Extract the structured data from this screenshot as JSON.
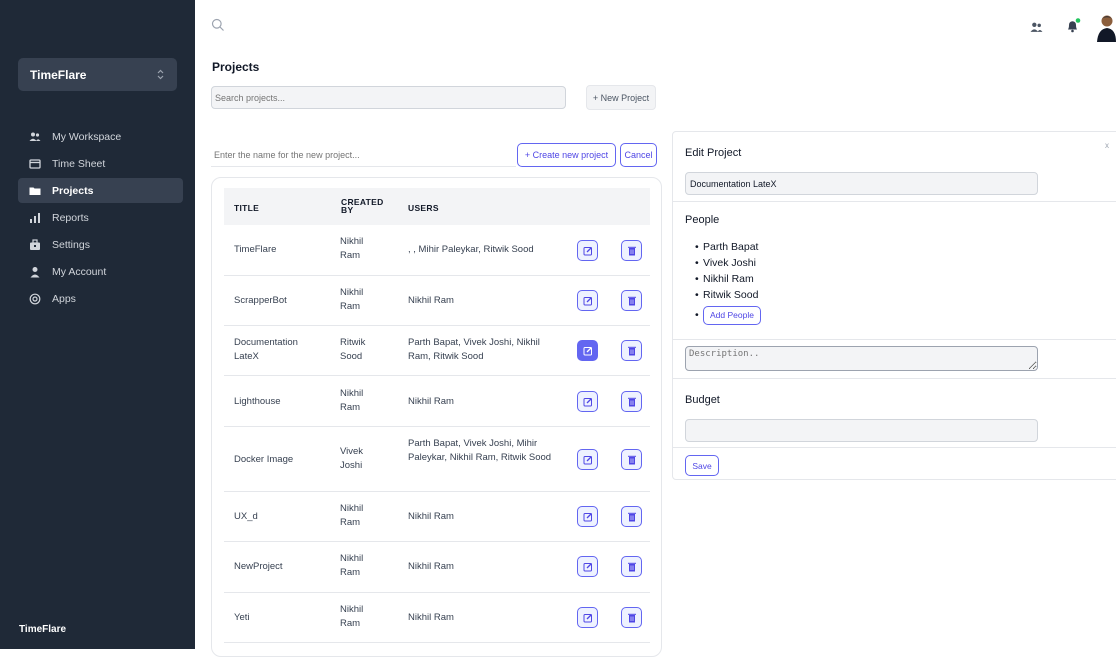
{
  "sidebar": {
    "workspace": "TimeFlare",
    "items": [
      {
        "label": "My Workspace",
        "icon": "users-icon"
      },
      {
        "label": "Time Sheet",
        "icon": "monitor-icon"
      },
      {
        "label": "Projects",
        "icon": "folder-icon",
        "active": true
      },
      {
        "label": "Reports",
        "icon": "bar-chart-icon"
      },
      {
        "label": "Settings",
        "icon": "briefcase-icon"
      },
      {
        "label": "My Account",
        "icon": "user-icon"
      },
      {
        "label": "Apps",
        "icon": "apps-icon"
      }
    ],
    "footer": "TimeFlare"
  },
  "header": {
    "page_title": "Projects",
    "search_placeholder": "Search projects...",
    "new_project_label": "+ New Project"
  },
  "new_project_form": {
    "placeholder": "Enter the name for the new project...",
    "create_label": "+ Create new project",
    "cancel_label": "Cancel"
  },
  "table": {
    "headers": {
      "title": "TITLE",
      "created_by": "CREATED BY",
      "users": "USERS"
    },
    "rows": [
      {
        "title": "TimeFlare",
        "created_by": "Nikhil Ram",
        "users": ", , Mihir Paleykar, Ritwik Sood"
      },
      {
        "title": "ScrapperBot",
        "created_by": "Nikhil Ram",
        "users": "Nikhil Ram"
      },
      {
        "title": "Documentation LateX",
        "created_by": "Ritwik Sood",
        "users": "Parth Bapat, Vivek Joshi, Nikhil Ram, Ritwik Sood",
        "editing": true
      },
      {
        "title": "Lighthouse",
        "created_by": "Nikhil Ram",
        "users": "Nikhil Ram"
      },
      {
        "title": "Docker Image",
        "created_by": "Vivek Joshi",
        "users": "Parth Bapat, Vivek Joshi, Mihir Paleykar, Nikhil Ram, Ritwik Sood"
      },
      {
        "title": "UX_d",
        "created_by": "Nikhil Ram",
        "users": "Nikhil Ram"
      },
      {
        "title": "NewProject",
        "created_by": "Nikhil Ram",
        "users": "Nikhil Ram"
      },
      {
        "title": "Yeti",
        "created_by": "Nikhil Ram",
        "users": "Nikhil Ram"
      }
    ]
  },
  "edit_panel": {
    "title": "Edit Project",
    "close": "x",
    "name_value": "Documentation LateX",
    "people_label": "People",
    "people": [
      "Parth Bapat",
      "Vivek Joshi",
      "Nikhil Ram",
      "Ritwik Sood"
    ],
    "add_people_label": "Add People",
    "description_placeholder": "Description..",
    "budget_label": "Budget",
    "save_label": "Save"
  },
  "colors": {
    "sidebar_bg": "#1f2937",
    "accent": "#6366f1",
    "notification_dot": "#22c55e"
  }
}
